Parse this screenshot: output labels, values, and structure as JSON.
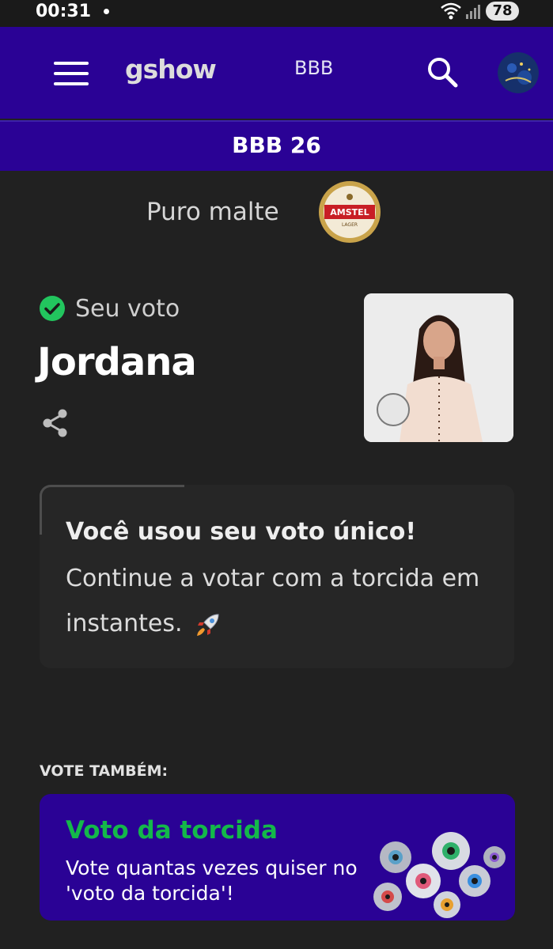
{
  "status_bar": {
    "time": "00:31",
    "battery": "78"
  },
  "header": {
    "logo": "gshow",
    "nav_label": "BBB",
    "section_title": "BBB 26"
  },
  "sponsor": {
    "text": "Puro malte",
    "logo_brand": "AMSTEL",
    "logo_sub": "LAGER"
  },
  "vote": {
    "status_label": "Seu voto",
    "candidate_name": "Jordana"
  },
  "info_card": {
    "title": "Você usou seu voto único!",
    "message": "Continue a votar com a torcida em instantes."
  },
  "vote_also": {
    "heading": "VOTE TAMBÉM:",
    "card_title": "Voto da torcida",
    "card_description": "Vote quantas vezes quiser no 'voto da torcida'!"
  },
  "colors": {
    "header_bg": "#2a0295",
    "page_bg": "#212121",
    "accent_green": "#14b84a",
    "check_green": "#22c55e"
  },
  "icons": [
    "menu-icon",
    "search-icon",
    "check-icon",
    "share-icon",
    "rocket-icon",
    "wifi-icon",
    "signal-icon"
  ]
}
